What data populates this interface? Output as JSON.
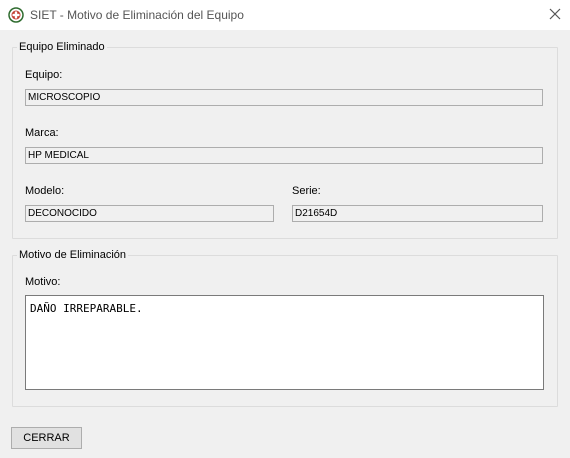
{
  "window": {
    "title": "SIET - Motivo de Eliminación del Equipo",
    "app_icon": "siet-logo-icon",
    "close_icon": "close-icon"
  },
  "equipo_group": {
    "title": "Equipo Eliminado",
    "equipo_label": "Equipo:",
    "equipo_value": "MICROSCOPIO",
    "marca_label": "Marca:",
    "marca_value": "HP MEDICAL",
    "modelo_label": "Modelo:",
    "modelo_value": "DECONOCIDO",
    "serie_label": "Serie:",
    "serie_value": "D21654D"
  },
  "motivo_group": {
    "title": "Motivo de Eliminación",
    "motivo_label": "Motivo:",
    "motivo_value": "DAÑO IRREPARABLE."
  },
  "buttons": {
    "close_label": "CERRAR"
  }
}
